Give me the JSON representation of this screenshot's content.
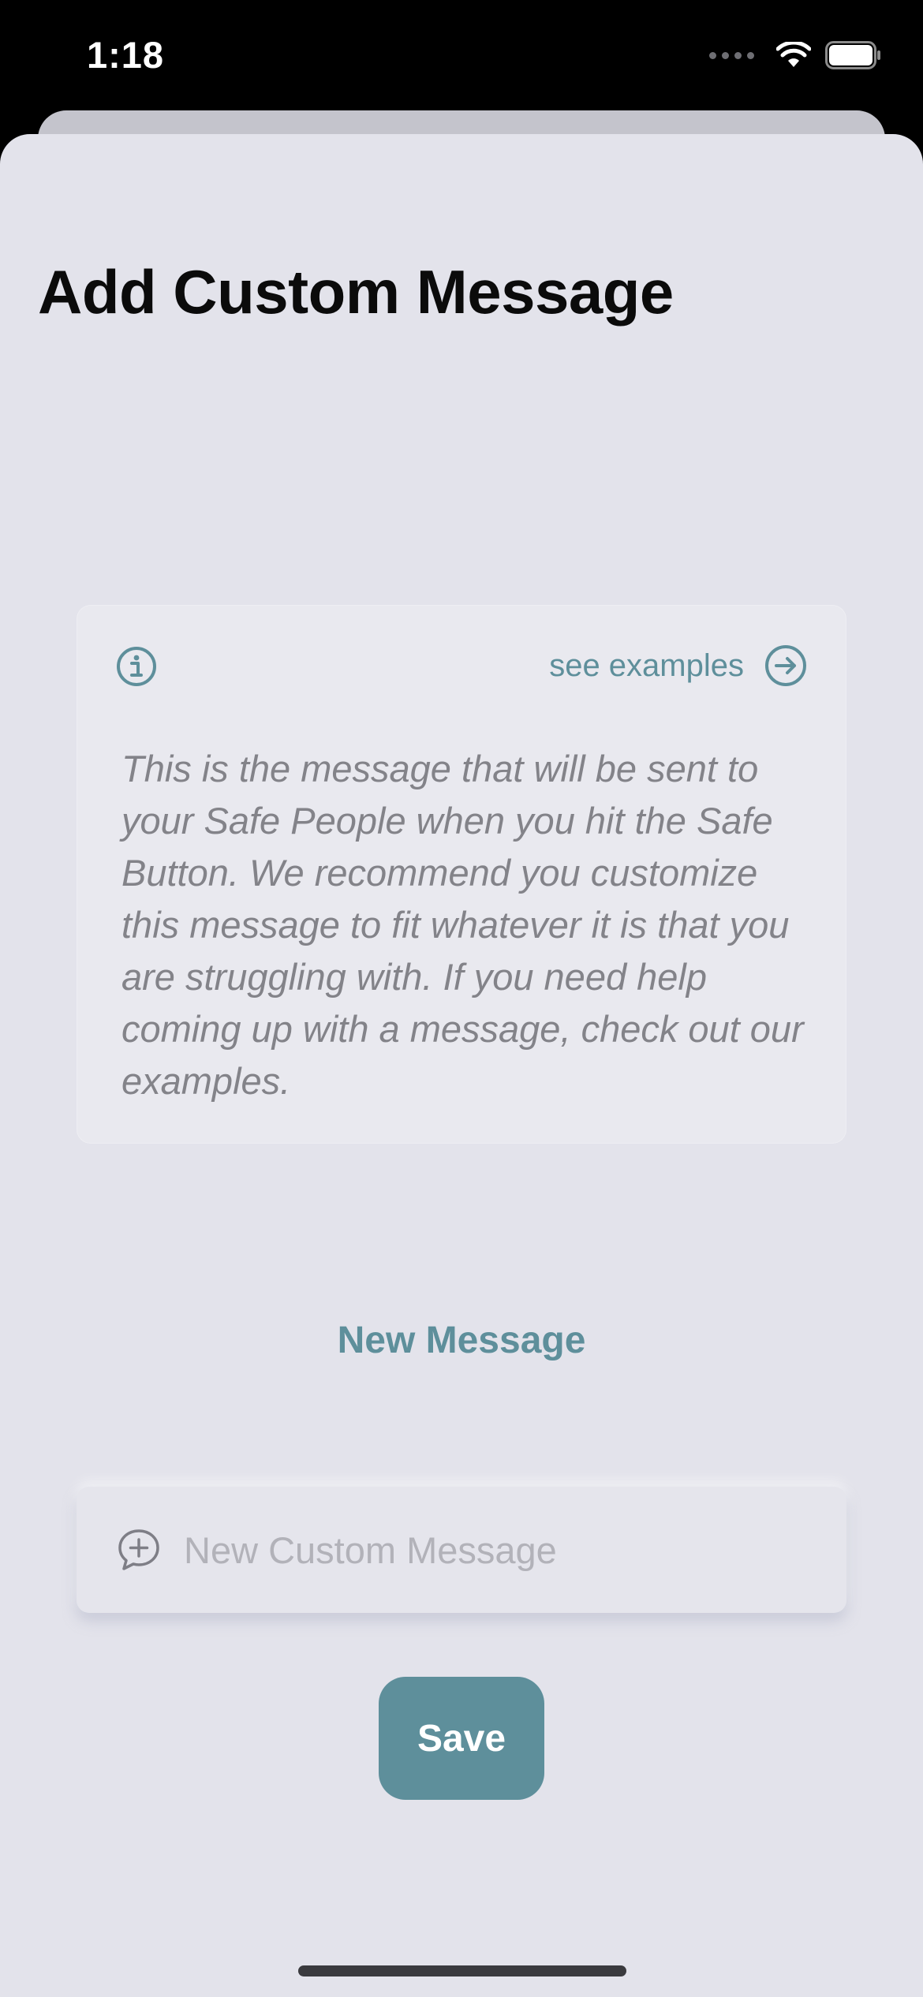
{
  "status_bar": {
    "time": "1:18"
  },
  "header": {
    "title": "Add Custom Message"
  },
  "info_card": {
    "see_examples_label": "see examples",
    "text": "This is the message that will be sent to your Safe People when you hit the Safe Button. We recommend you customize this message to fit whatever it is that you are struggling with. If you need help coming up with a message, check out our examples."
  },
  "new_message": {
    "heading": "New Message",
    "input_value": "",
    "input_placeholder": "New Custom Message"
  },
  "actions": {
    "save_label": "Save"
  },
  "icons": {
    "info": "info-circle-icon",
    "arrow": "arrow-right-circle-icon",
    "message": "message-add-icon",
    "wifi": "wifi-icon",
    "battery": "battery-icon",
    "signal": "cellular-signal-icon"
  },
  "colors": {
    "accent": "#5e8f9b",
    "background": "#e3e3eb",
    "card": "#e9e9ef",
    "body_text": "#838389",
    "placeholder": "#b2b2b9"
  }
}
